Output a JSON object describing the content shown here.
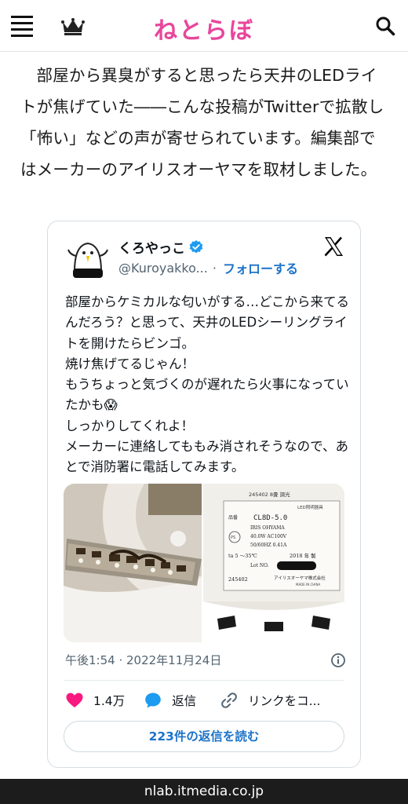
{
  "header": {
    "logo": "ねとらぼ",
    "menu_icon": "hamburger-menu-icon",
    "ranking_icon": "crown-icon",
    "search_icon": "search-icon"
  },
  "article": {
    "lead": "部屋から異臭がすると思ったら天井のLEDライトが焦げていた――こんな投稿がTwitterで拡散し「怖い」などの声が寄せられています。編集部ではメーカーのアイリスオーヤマを取材しました。"
  },
  "tweet": {
    "author_name": "くろやっこ",
    "handle": "@Kuroyakko...",
    "dot": "·",
    "follow_label": "フォローする",
    "text": "部屋からケミカルな匂いがする…どこから来てるんだろう？と思って、天井のLEDシーリングライトを開けたらビンゴ。\n焼け焦げてるじゃん！\nもうちょっと気づくのが遅れたら火事になっていたかも😱\nしっかりしてくれよ！\nメーカーに連絡してももみ消されそうなので、あとで消防署に電話してみます。",
    "timestamp": "午後1:54 · 2022年11月24日",
    "likes": "1.4万",
    "reply_label": "返信",
    "copy_link_label": "リンクをコ...",
    "read_replies_label": "223件の返信を読む",
    "label_photo": {
      "code": "245402",
      "model": "CL8D-5.0",
      "brand": "IRIS OHYAMA",
      "spec1": "40.0W AC100V",
      "spec2": "50/60HZ 0.41A",
      "temp": "ta 5 ～35℃",
      "year": "2018 年 製",
      "lot": "Lot NO.",
      "maker": "アイリスオーヤマ株式会社",
      "origin": "MADE IN CHINA",
      "title_small": "LED照明器具",
      "top_text": "245402 8畳 調光"
    }
  },
  "colors": {
    "brand_pink": "#e8469b",
    "link_blue": "#1d73c9",
    "heart": "#f91880",
    "reply_blue": "#1d9bf0"
  },
  "url_bar": {
    "domain": "nlab.itmedia.co.jp"
  }
}
